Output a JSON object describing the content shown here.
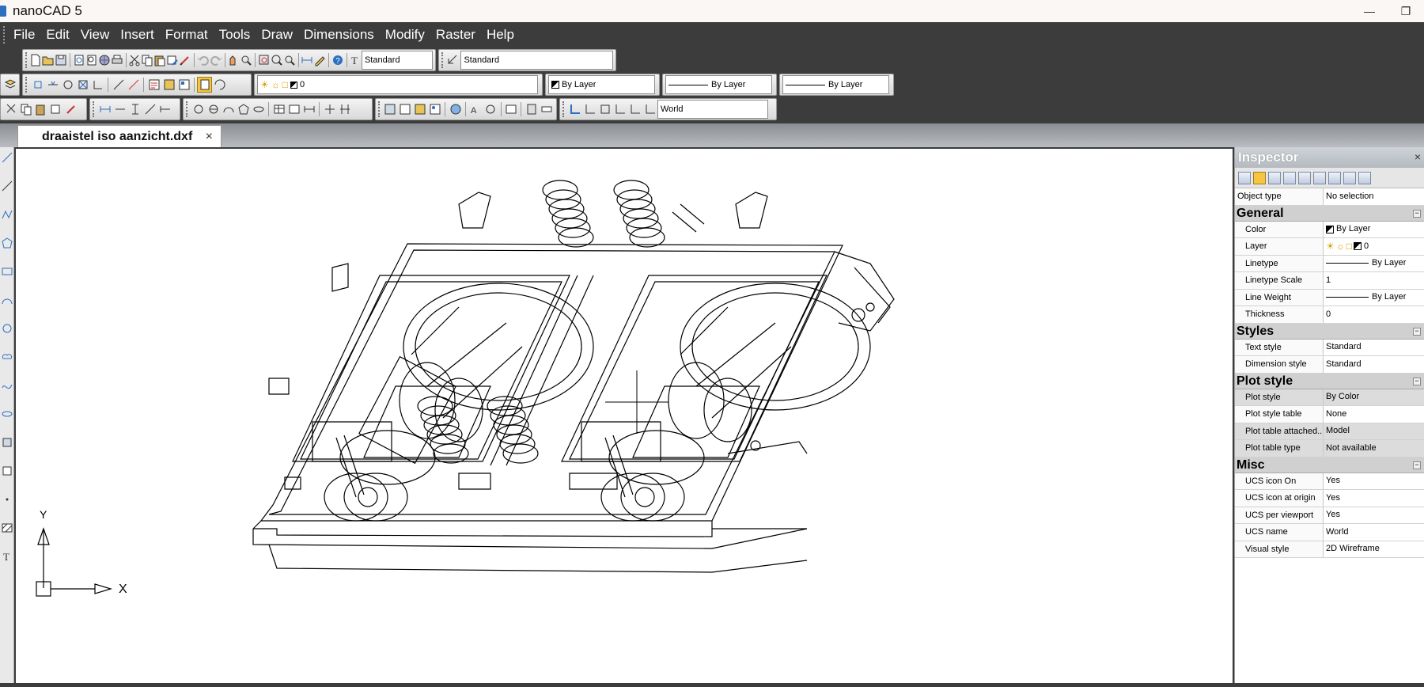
{
  "app": {
    "title": "nanoCAD 5"
  },
  "menu": [
    "File",
    "Edit",
    "View",
    "Insert",
    "Format",
    "Tools",
    "Draw",
    "Dimensions",
    "Modify",
    "Raster",
    "Help"
  ],
  "toolbars": {
    "text_style": "Standard",
    "dim_style": "Standard",
    "layer": "0",
    "color": "By Layer",
    "linetype": "By Layer",
    "lineweight": "By Layer",
    "ucs": "World"
  },
  "document": {
    "tab_label": "draaistel iso aanzicht.dxf",
    "close_glyph": "×"
  },
  "ucs_icon": {
    "y_label": "Y",
    "x_label": "X"
  },
  "inspector": {
    "title": "Inspector",
    "close_glyph": "×",
    "object_type_label": "Object type",
    "object_type_value": "No selection",
    "sections": [
      {
        "name": "General",
        "rows": [
          {
            "key": "Color",
            "value": "By Layer"
          },
          {
            "key": "Layer",
            "value": "0"
          },
          {
            "key": "Linetype",
            "value": "By Layer"
          },
          {
            "key": "Linetype Scale",
            "value": "1"
          },
          {
            "key": "Line Weight",
            "value": "By Layer"
          },
          {
            "key": "Thickness",
            "value": "0"
          }
        ]
      },
      {
        "name": "Styles",
        "rows": [
          {
            "key": "Text style",
            "value": "Standard"
          },
          {
            "key": "Dimension style",
            "value": "Standard"
          }
        ]
      },
      {
        "name": "Plot style",
        "rows": [
          {
            "key": "Plot style",
            "value": "By Color"
          },
          {
            "key": "Plot style table",
            "value": "None"
          },
          {
            "key": "Plot table attached...",
            "value": "Model"
          },
          {
            "key": "Plot table type",
            "value": "Not available"
          }
        ]
      },
      {
        "name": "Misc",
        "rows": [
          {
            "key": "UCS icon On",
            "value": "Yes"
          },
          {
            "key": "UCS icon at origin",
            "value": "Yes"
          },
          {
            "key": "UCS per viewport",
            "value": "Yes"
          },
          {
            "key": "UCS name",
            "value": "World"
          },
          {
            "key": "Visual style",
            "value": "2D Wireframe"
          }
        ]
      }
    ]
  }
}
